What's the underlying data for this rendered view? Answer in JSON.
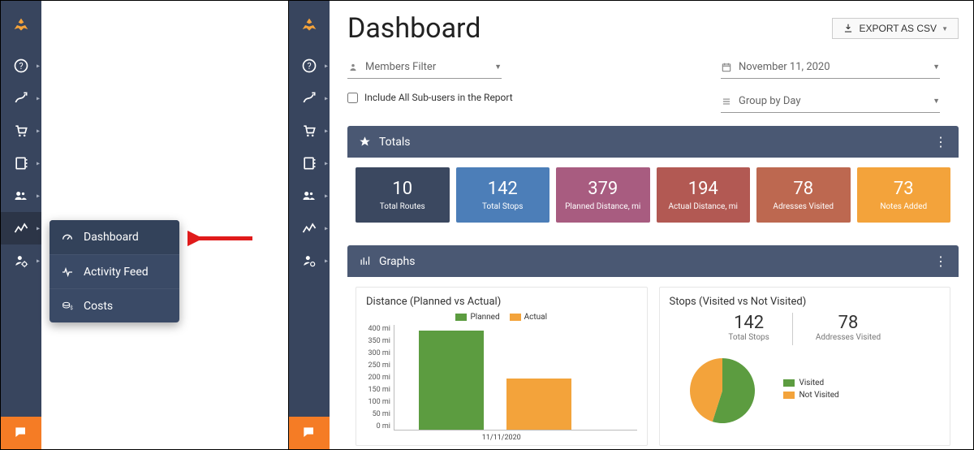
{
  "page_title": "Dashboard",
  "export_label": "EXPORT AS CSV",
  "members_filter_placeholder": "Members Filter",
  "include_subusers_label": "Include All Sub-users in the Report",
  "date_value": "November 11, 2020",
  "group_value": "Group by Day",
  "totals_header": "Totals",
  "graphs_header": "Graphs",
  "totals": [
    {
      "value": "10",
      "label": "Total Routes",
      "color": "#3b4860"
    },
    {
      "value": "142",
      "label": "Total Stops",
      "color": "#4c7eb8"
    },
    {
      "value": "379",
      "label": "Planned Distance, mi",
      "color": "#a85c80"
    },
    {
      "value": "194",
      "label": "Actual Distance, mi",
      "color": "#b25953"
    },
    {
      "value": "78",
      "label": "Adresses Visited",
      "color": "#bd6850"
    },
    {
      "value": "73",
      "label": "Notes Added",
      "color": "#f3a33b"
    }
  ],
  "flyout": [
    {
      "label": "Dashboard",
      "icon": "gauge-icon"
    },
    {
      "label": "Activity Feed",
      "icon": "pulse-icon"
    },
    {
      "label": "Costs",
      "icon": "coins-icon"
    }
  ],
  "chart_data": [
    {
      "type": "bar",
      "title": "Distance (Planned vs Actual)",
      "categories": [
        "11/11/2020"
      ],
      "series": [
        {
          "name": "Planned",
          "values": [
            379
          ],
          "color": "#5c9c40"
        },
        {
          "name": "Actual",
          "values": [
            194
          ],
          "color": "#f3a33b"
        }
      ],
      "ylabel": "mi",
      "ylim": [
        0,
        400
      ],
      "yticks": [
        0,
        50,
        100,
        150,
        200,
        250,
        300,
        350,
        400
      ]
    },
    {
      "type": "pie",
      "title": "Stops (Visited vs Not Visited)",
      "stats": [
        {
          "value": "142",
          "label": "Total Stops"
        },
        {
          "value": "78",
          "label": "Addresses Visited"
        }
      ],
      "series": [
        {
          "name": "Visited",
          "value": 78,
          "color": "#5c9c40"
        },
        {
          "name": "Not Visited",
          "value": 64,
          "color": "#f3a33b"
        }
      ]
    }
  ]
}
